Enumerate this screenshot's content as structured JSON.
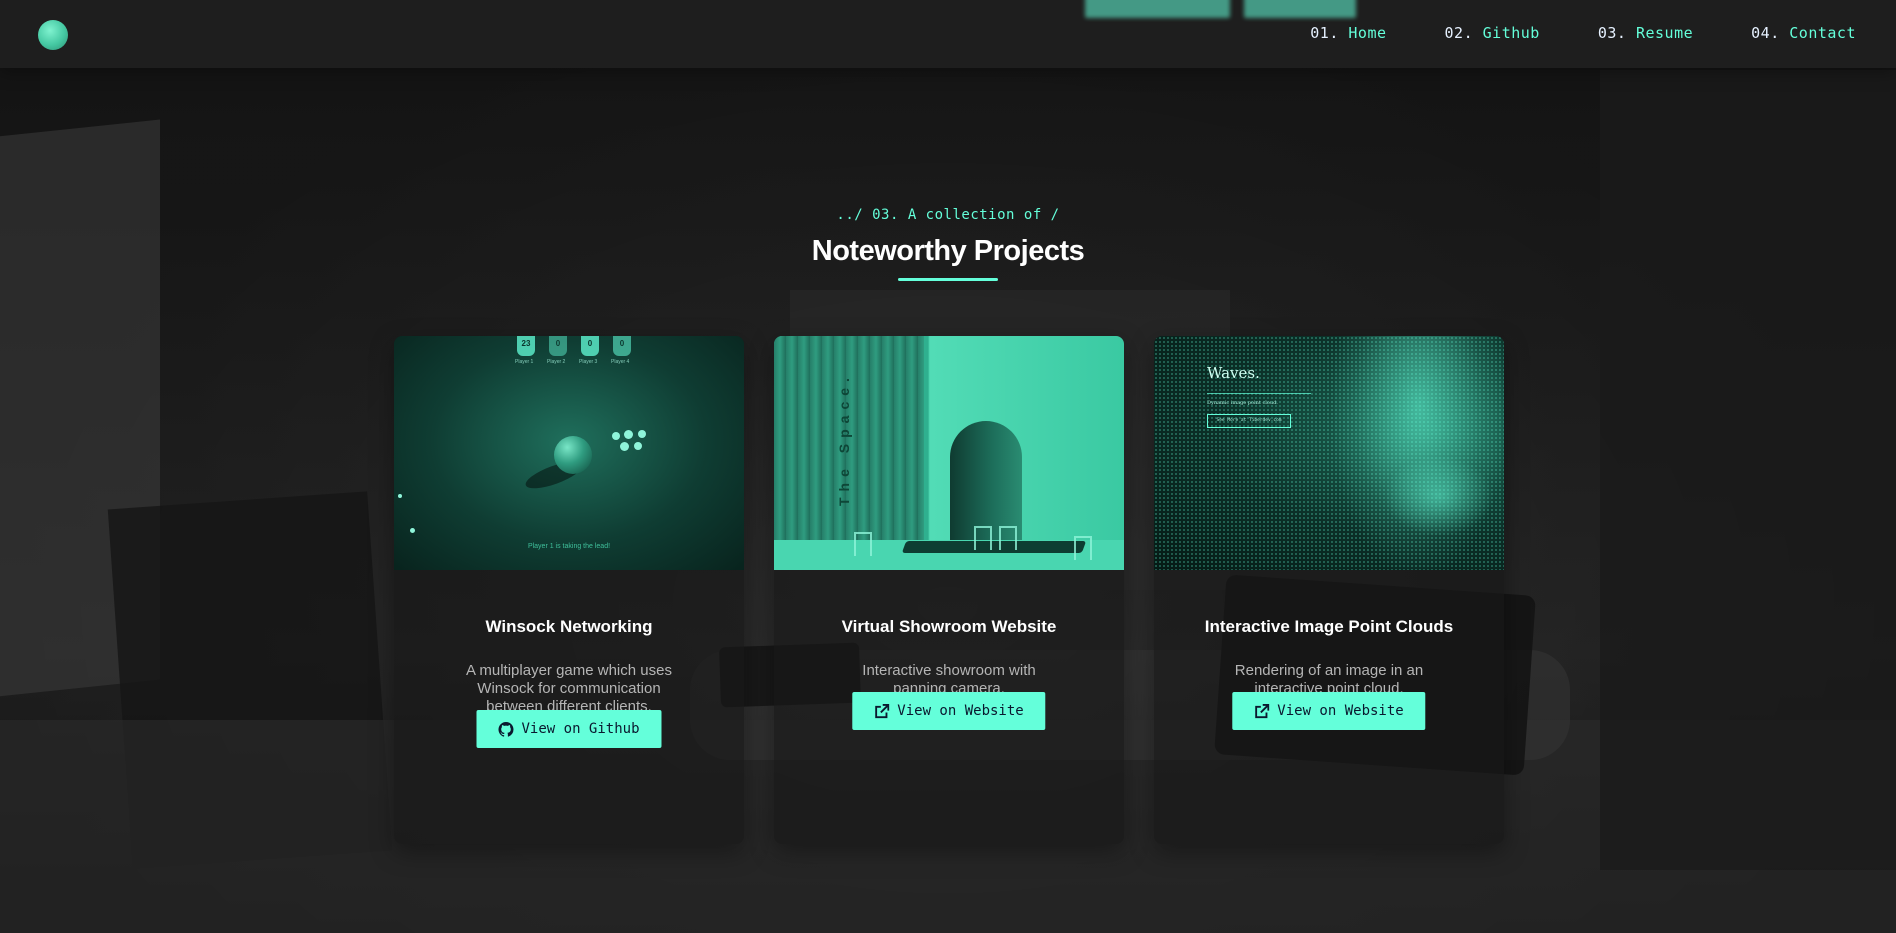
{
  "nav": {
    "links": [
      {
        "num": "01.",
        "label": "Home"
      },
      {
        "num": "02.",
        "label": "Github"
      },
      {
        "num": "03.",
        "label": "Resume"
      },
      {
        "num": "04.",
        "label": "Contact"
      }
    ]
  },
  "section": {
    "eyebrow": "../ 03. A collection of /",
    "title": "Noteworthy Projects"
  },
  "projects": [
    {
      "title": "Winsock Networking",
      "description": "A multiplayer game which uses Winsock for communication between different clients.",
      "button_label": "View on Github",
      "button_icon": "github-icon",
      "thumb": {
        "scores": [
          "23",
          "0",
          "0",
          "0"
        ],
        "players": [
          "Player 1",
          "Player 2",
          "Player 3",
          "Player 4"
        ],
        "message": "Player 1 is taking the lead!"
      }
    },
    {
      "title": "Virtual Showroom Website",
      "description": "Interactive showroom with panning camera.",
      "button_label": "View on Website",
      "button_icon": "external-link-icon",
      "thumb": {
        "vertical_text": "The Space."
      }
    },
    {
      "title": "Interactive Image Point Clouds",
      "description": "Rendering of an image in an interactive point cloud.",
      "button_label": "View on Website",
      "button_icon": "external-link-icon",
      "thumb": {
        "heading": "Waves.",
        "subtitle": "Dynamic image point cloud.",
        "button": "See More at Tiberdev.com"
      }
    }
  ],
  "colors": {
    "accent": "#64ffda",
    "background": "#1c1c1c",
    "card": "#161616"
  }
}
